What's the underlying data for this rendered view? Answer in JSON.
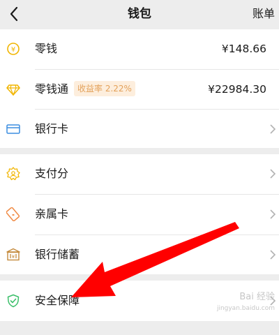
{
  "header": {
    "title": "钱包",
    "bill_label": "账单"
  },
  "groups": [
    {
      "rows": [
        {
          "label": "零钱",
          "value": "¥148.66",
          "icon": "coin-icon"
        },
        {
          "label": "零钱通",
          "badge": "收益率 2.22%",
          "value": "¥22984.30",
          "icon": "diamond-icon"
        },
        {
          "label": "银行卡",
          "icon": "bank-card-icon"
        }
      ]
    },
    {
      "rows": [
        {
          "label": "支付分",
          "icon": "pay-score-icon"
        },
        {
          "label": "亲属卡",
          "icon": "family-card-icon"
        },
        {
          "label": "银行储蓄",
          "icon": "bank-savings-icon"
        }
      ]
    },
    {
      "rows": [
        {
          "label": "安全保障",
          "icon": "security-shield-icon"
        }
      ]
    }
  ],
  "watermark": {
    "text": "Bai 经验",
    "url": "jingyan.baidu.com"
  },
  "colors": {
    "background": "#ededed",
    "card": "#ffffff",
    "coin_icon": "#f1b500",
    "card_icon": "#3b8de0",
    "pay_score_icon": "#f1b500",
    "family_card_icon": "#f08a44",
    "bank_savings_icon": "#c48a3c",
    "shield_icon": "#3bbf6a",
    "badge_bg": "#fdeedd",
    "badge_text": "#e3a15a",
    "annotation_arrow": "#ff0000"
  }
}
